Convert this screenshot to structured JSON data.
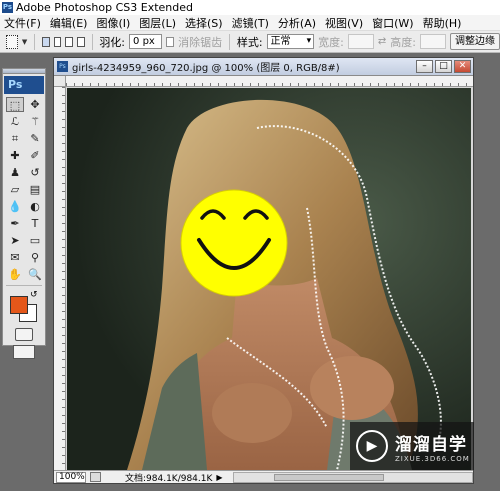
{
  "app": {
    "title": "Adobe Photoshop CS3 Extended",
    "logo": "Ps"
  },
  "menu": [
    "文件(F)",
    "编辑(E)",
    "图像(I)",
    "图层(L)",
    "选择(S)",
    "滤镜(T)",
    "分析(A)",
    "视图(V)",
    "窗口(W)",
    "帮助(H)"
  ],
  "options": {
    "feather_label": "羽化:",
    "feather_value": "0 px",
    "antialias_label": "消除锯齿",
    "style_label": "样式:",
    "style_value": "正常",
    "width_label": "宽度:",
    "height_label": "高度:",
    "refine_button": "调整边缘"
  },
  "tools": {
    "icons": [
      "rect-marquee-icon",
      "move-icon",
      "lasso-icon",
      "magic-wand-icon",
      "crop-icon",
      "slice-icon",
      "healing-icon",
      "brush-icon",
      "stamp-icon",
      "history-brush-icon",
      "eraser-icon",
      "gradient-icon",
      "blur-icon",
      "dodge-icon",
      "pen-icon",
      "type-icon",
      "path-select-icon",
      "shape-icon",
      "notes-icon",
      "eyedropper-icon",
      "hand-icon",
      "zoom-icon"
    ],
    "foreground_color": "#e4571a",
    "background_color": "#ffffff"
  },
  "document": {
    "title": "girls-4234959_960_720.jpg @ 100% (图层 0, RGB/8#)",
    "zoom": "100%",
    "doc_info": "文档:984.1K/984.1K"
  },
  "watermark": {
    "title": "溜溜自学",
    "url": "ZIXUE.3D66.COM"
  }
}
